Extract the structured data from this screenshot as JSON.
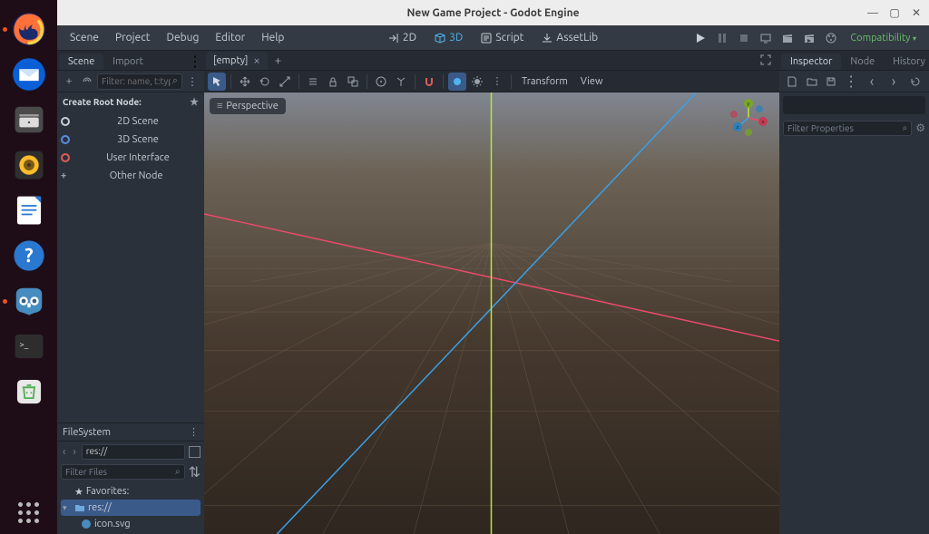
{
  "titlebar": {
    "title": "New Game Project - Godot Engine"
  },
  "menubar": {
    "items": [
      "Scene",
      "Project",
      "Debug",
      "Editor",
      "Help"
    ],
    "workspaces": {
      "w2d": "2D",
      "w3d": "3D",
      "script": "Script",
      "assetlib": "AssetLib"
    },
    "renderer": "Compatibility"
  },
  "scene_panel": {
    "tab_scene": "Scene",
    "tab_import": "Import",
    "filter_placeholder": "Filter: name, t:type, g:",
    "create_label": "Create Root Node:",
    "opts": {
      "scene2d": "2D Scene",
      "scene3d": "3D Scene",
      "ui": "User Interface",
      "other": "Other Node"
    }
  },
  "viewport": {
    "doc_tab": "[empty]",
    "perspective": "Perspective",
    "menu_transform": "Transform",
    "menu_view": "View"
  },
  "filesystem": {
    "title": "FileSystem",
    "path": "res://",
    "filter_placeholder": "Filter Files",
    "favorites": "Favorites:",
    "root": "res://",
    "file1": "icon.svg"
  },
  "inspector": {
    "tab_inspector": "Inspector",
    "tab_node": "Node",
    "tab_history": "History",
    "filter_placeholder": "Filter Properties"
  }
}
